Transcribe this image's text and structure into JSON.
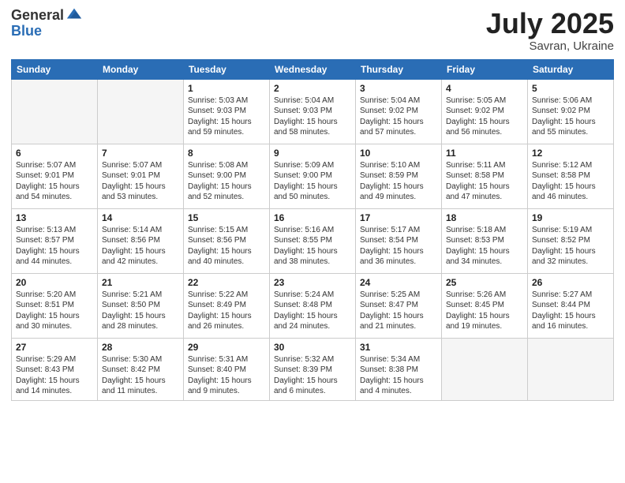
{
  "header": {
    "logo_general": "General",
    "logo_blue": "Blue",
    "title": "July 2025",
    "location": "Savran, Ukraine"
  },
  "weekdays": [
    "Sunday",
    "Monday",
    "Tuesday",
    "Wednesday",
    "Thursday",
    "Friday",
    "Saturday"
  ],
  "weeks": [
    [
      {
        "day": "",
        "info": ""
      },
      {
        "day": "",
        "info": ""
      },
      {
        "day": "1",
        "info": "Sunrise: 5:03 AM\nSunset: 9:03 PM\nDaylight: 15 hours\nand 59 minutes."
      },
      {
        "day": "2",
        "info": "Sunrise: 5:04 AM\nSunset: 9:03 PM\nDaylight: 15 hours\nand 58 minutes."
      },
      {
        "day": "3",
        "info": "Sunrise: 5:04 AM\nSunset: 9:02 PM\nDaylight: 15 hours\nand 57 minutes."
      },
      {
        "day": "4",
        "info": "Sunrise: 5:05 AM\nSunset: 9:02 PM\nDaylight: 15 hours\nand 56 minutes."
      },
      {
        "day": "5",
        "info": "Sunrise: 5:06 AM\nSunset: 9:02 PM\nDaylight: 15 hours\nand 55 minutes."
      }
    ],
    [
      {
        "day": "6",
        "info": "Sunrise: 5:07 AM\nSunset: 9:01 PM\nDaylight: 15 hours\nand 54 minutes."
      },
      {
        "day": "7",
        "info": "Sunrise: 5:07 AM\nSunset: 9:01 PM\nDaylight: 15 hours\nand 53 minutes."
      },
      {
        "day": "8",
        "info": "Sunrise: 5:08 AM\nSunset: 9:00 PM\nDaylight: 15 hours\nand 52 minutes."
      },
      {
        "day": "9",
        "info": "Sunrise: 5:09 AM\nSunset: 9:00 PM\nDaylight: 15 hours\nand 50 minutes."
      },
      {
        "day": "10",
        "info": "Sunrise: 5:10 AM\nSunset: 8:59 PM\nDaylight: 15 hours\nand 49 minutes."
      },
      {
        "day": "11",
        "info": "Sunrise: 5:11 AM\nSunset: 8:58 PM\nDaylight: 15 hours\nand 47 minutes."
      },
      {
        "day": "12",
        "info": "Sunrise: 5:12 AM\nSunset: 8:58 PM\nDaylight: 15 hours\nand 46 minutes."
      }
    ],
    [
      {
        "day": "13",
        "info": "Sunrise: 5:13 AM\nSunset: 8:57 PM\nDaylight: 15 hours\nand 44 minutes."
      },
      {
        "day": "14",
        "info": "Sunrise: 5:14 AM\nSunset: 8:56 PM\nDaylight: 15 hours\nand 42 minutes."
      },
      {
        "day": "15",
        "info": "Sunrise: 5:15 AM\nSunset: 8:56 PM\nDaylight: 15 hours\nand 40 minutes."
      },
      {
        "day": "16",
        "info": "Sunrise: 5:16 AM\nSunset: 8:55 PM\nDaylight: 15 hours\nand 38 minutes."
      },
      {
        "day": "17",
        "info": "Sunrise: 5:17 AM\nSunset: 8:54 PM\nDaylight: 15 hours\nand 36 minutes."
      },
      {
        "day": "18",
        "info": "Sunrise: 5:18 AM\nSunset: 8:53 PM\nDaylight: 15 hours\nand 34 minutes."
      },
      {
        "day": "19",
        "info": "Sunrise: 5:19 AM\nSunset: 8:52 PM\nDaylight: 15 hours\nand 32 minutes."
      }
    ],
    [
      {
        "day": "20",
        "info": "Sunrise: 5:20 AM\nSunset: 8:51 PM\nDaylight: 15 hours\nand 30 minutes."
      },
      {
        "day": "21",
        "info": "Sunrise: 5:21 AM\nSunset: 8:50 PM\nDaylight: 15 hours\nand 28 minutes."
      },
      {
        "day": "22",
        "info": "Sunrise: 5:22 AM\nSunset: 8:49 PM\nDaylight: 15 hours\nand 26 minutes."
      },
      {
        "day": "23",
        "info": "Sunrise: 5:24 AM\nSunset: 8:48 PM\nDaylight: 15 hours\nand 24 minutes."
      },
      {
        "day": "24",
        "info": "Sunrise: 5:25 AM\nSunset: 8:47 PM\nDaylight: 15 hours\nand 21 minutes."
      },
      {
        "day": "25",
        "info": "Sunrise: 5:26 AM\nSunset: 8:45 PM\nDaylight: 15 hours\nand 19 minutes."
      },
      {
        "day": "26",
        "info": "Sunrise: 5:27 AM\nSunset: 8:44 PM\nDaylight: 15 hours\nand 16 minutes."
      }
    ],
    [
      {
        "day": "27",
        "info": "Sunrise: 5:29 AM\nSunset: 8:43 PM\nDaylight: 15 hours\nand 14 minutes."
      },
      {
        "day": "28",
        "info": "Sunrise: 5:30 AM\nSunset: 8:42 PM\nDaylight: 15 hours\nand 11 minutes."
      },
      {
        "day": "29",
        "info": "Sunrise: 5:31 AM\nSunset: 8:40 PM\nDaylight: 15 hours\nand 9 minutes."
      },
      {
        "day": "30",
        "info": "Sunrise: 5:32 AM\nSunset: 8:39 PM\nDaylight: 15 hours\nand 6 minutes."
      },
      {
        "day": "31",
        "info": "Sunrise: 5:34 AM\nSunset: 8:38 PM\nDaylight: 15 hours\nand 4 minutes."
      },
      {
        "day": "",
        "info": ""
      },
      {
        "day": "",
        "info": ""
      }
    ]
  ]
}
